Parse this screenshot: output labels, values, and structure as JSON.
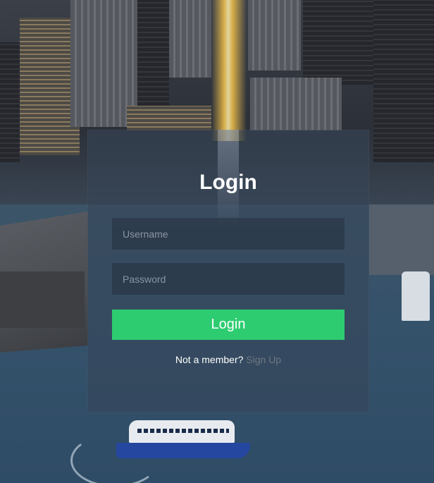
{
  "login": {
    "title": "Login",
    "username_placeholder": "Username",
    "password_placeholder": "Password",
    "button_label": "Login",
    "footer_text": "Not a member?",
    "signup_link": "Sign Up"
  },
  "colors": {
    "button": "#2ecc71",
    "link": "#6f7780",
    "panel": "rgba(55,70,88,0.55)"
  }
}
